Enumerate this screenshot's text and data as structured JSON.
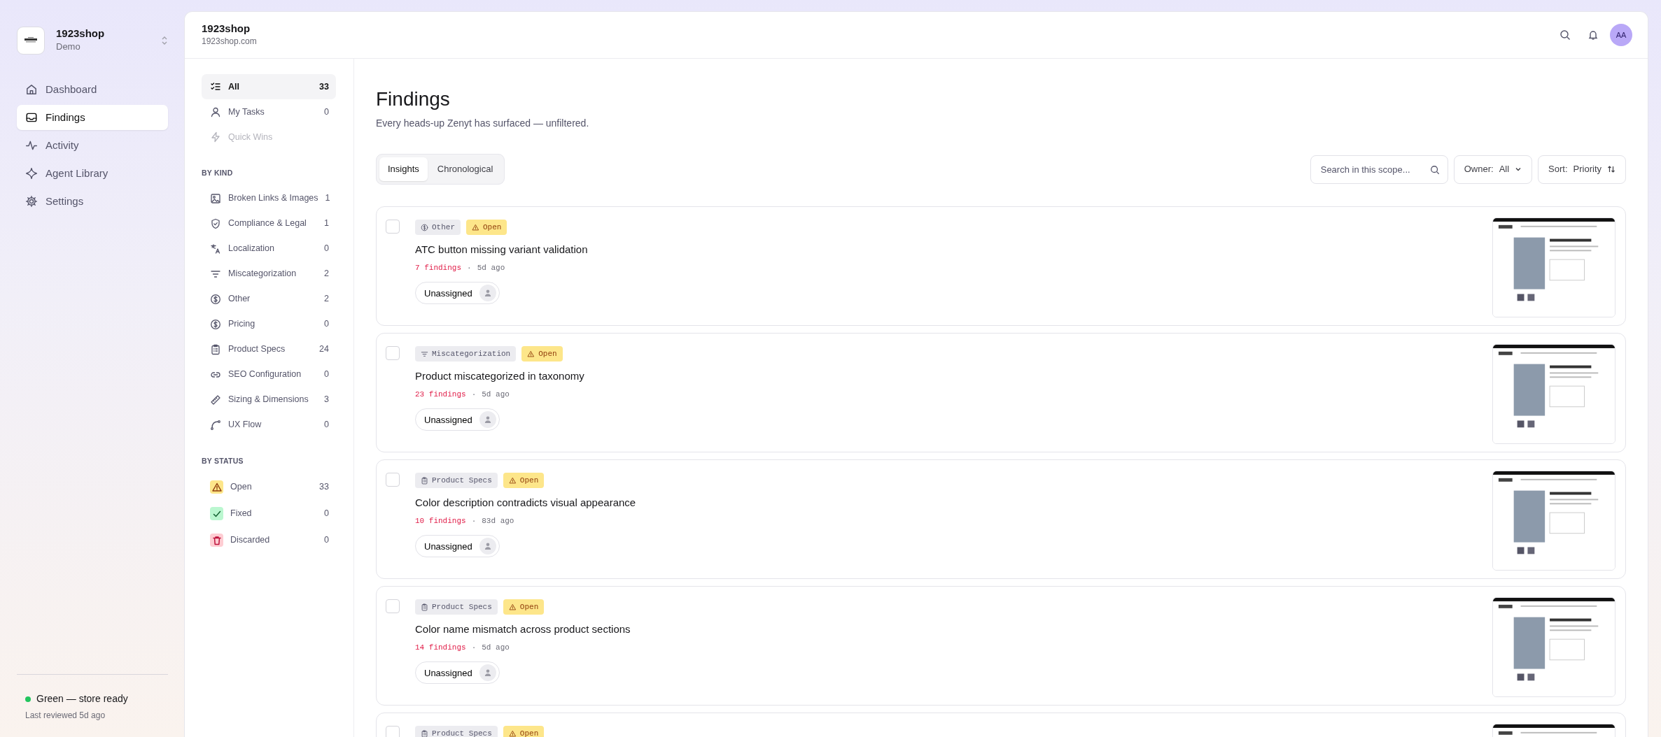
{
  "workspace": {
    "name": "1923shop",
    "plan": "Demo"
  },
  "nav": [
    {
      "label": "Dashboard",
      "selected": false
    },
    {
      "label": "Findings",
      "selected": true
    },
    {
      "label": "Activity",
      "selected": false
    },
    {
      "label": "Agent Library",
      "selected": false
    },
    {
      "label": "Settings",
      "selected": false
    }
  ],
  "store_status": {
    "label": "Green — store ready",
    "color": "#22c55e",
    "note": "Last reviewed 5d ago"
  },
  "header": {
    "title": "1923shop",
    "domain": "1923shop.com",
    "avatar": "AA"
  },
  "filters": {
    "views": [
      {
        "label": "All",
        "count": "33",
        "selected": true,
        "disabled": false
      },
      {
        "label": "My Tasks",
        "count": "0",
        "selected": false,
        "disabled": false
      },
      {
        "label": "Quick Wins",
        "selected": false,
        "disabled": true
      }
    ],
    "by_kind_title": "BY KIND",
    "by_kind": [
      {
        "label": "Broken Links & Images",
        "count": "1",
        "selected": false
      },
      {
        "label": "Compliance & Legal",
        "count": "1",
        "selected": false
      },
      {
        "label": "Localization",
        "count": "0",
        "selected": false
      },
      {
        "label": "Miscategorization",
        "count": "2",
        "selected": false
      },
      {
        "label": "Other",
        "count": "2",
        "selected": false
      },
      {
        "label": "Pricing",
        "count": "0",
        "selected": false
      },
      {
        "label": "Product Specs",
        "count": "24",
        "selected": false
      },
      {
        "label": "SEO Configuration",
        "count": "0",
        "selected": false
      },
      {
        "label": "Sizing & Dimensions",
        "count": "3",
        "selected": false
      },
      {
        "label": "UX Flow",
        "count": "0",
        "selected": false
      }
    ],
    "by_status_title": "BY STATUS",
    "by_status": [
      {
        "label": "Open",
        "count": "33",
        "color": "#fde68a",
        "selected": false
      },
      {
        "label": "Fixed",
        "count": "0",
        "color": "#bbf7d0",
        "selected": false
      },
      {
        "label": "Discarded",
        "count": "0",
        "color": "#fecdd3",
        "selected": false
      }
    ]
  },
  "page": {
    "title": "Findings",
    "subtitle": "Every heads-up Zenyt has surfaced — unfiltered."
  },
  "view_tabs": [
    {
      "label": "Insights",
      "selected": true
    },
    {
      "label": "Chronological",
      "selected": false
    }
  ],
  "search": {
    "placeholder": "Search in this scope..."
  },
  "owner": {
    "label": "Owner:",
    "value": "All"
  },
  "sort": {
    "label": "Sort:",
    "value": "Priority"
  },
  "findings": [
    {
      "checked": false,
      "kind_tag": "Other",
      "status_tag": "Open",
      "title": "ATC button missing variant validation",
      "count": "7 findings",
      "separator": "·",
      "age": "5d ago",
      "assignee": "Unassigned"
    },
    {
      "checked": false,
      "kind_tag": "Miscategorization",
      "status_tag": "Open",
      "title": "Product miscategorized in taxonomy",
      "count": "23 findings",
      "separator": "·",
      "age": "5d ago",
      "assignee": "Unassigned"
    },
    {
      "checked": false,
      "kind_tag": "Product Specs",
      "status_tag": "Open",
      "title": "Color description contradicts visual appearance",
      "count": "10 findings",
      "separator": "·",
      "age": "83d ago",
      "assignee": "Unassigned"
    },
    {
      "checked": false,
      "kind_tag": "Product Specs",
      "status_tag": "Open",
      "title": "Color name mismatch across product sections",
      "count": "14 findings",
      "separator": "·",
      "age": "5d ago",
      "assignee": "Unassigned"
    },
    {
      "checked": false,
      "kind_tag": "Product Specs",
      "status_tag": "Open"
    }
  ]
}
